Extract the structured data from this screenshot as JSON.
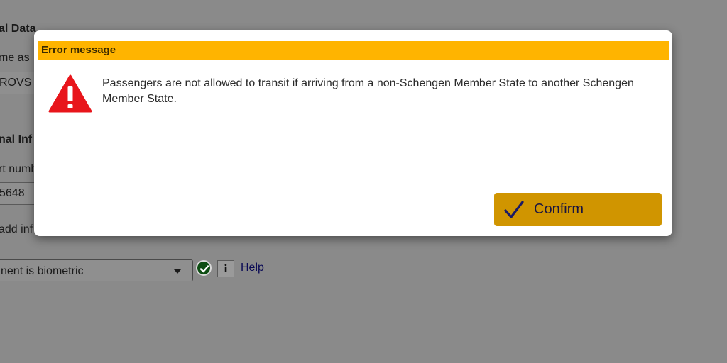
{
  "background": {
    "section1_heading": "al Data",
    "name_label": "me as",
    "name_value": "ROVS",
    "section2_heading": "nal Inf",
    "document_number_label": "rt numb",
    "document_number_value": "5648",
    "add_info_label": "add inf",
    "biometric_select_value": "nent is biometric",
    "help_link": "Help",
    "info_button": "i"
  },
  "modal": {
    "title": "Error message",
    "message": "Passengers are not allowed to transit if arriving from a non-Schengen Member State to another Schengen Member State.",
    "confirm_label": "Confirm",
    "icons": {
      "warning": "warning-triangle-icon",
      "confirm": "checkmark-icon",
      "valid": "check-circle-icon",
      "info": "info-icon",
      "dropdown": "chevron-down-icon"
    }
  },
  "colors": {
    "title_bar": "#ffb400",
    "confirm_button": "#d09500",
    "warning_icon": "#e8151b",
    "backdrop": "#8a8a8a"
  }
}
